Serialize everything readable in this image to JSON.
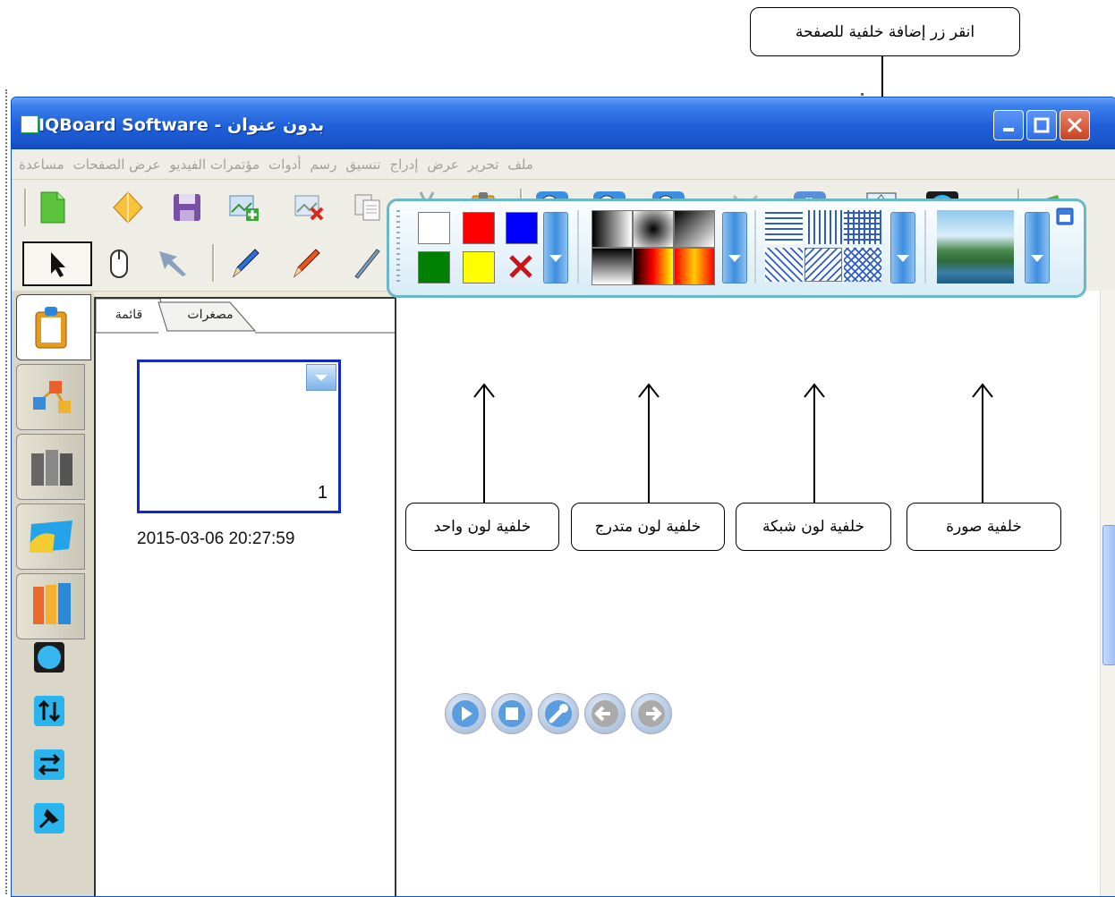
{
  "window": {
    "title": "IQBoard Software - بدون عنوان",
    "controls": [
      "minimize",
      "maximize",
      "close"
    ]
  },
  "menu": {
    "items": [
      "ملف",
      "تحرير",
      "عرض",
      "إدراج",
      "تنسيق",
      "رسم",
      "أدوات",
      "مؤتمرات الفيديو",
      "عرض الصفحات",
      "مساعدة"
    ]
  },
  "panel": {
    "tabs": [
      "قائمة",
      "مصغرات"
    ],
    "page_number": "1",
    "page_timestamp": "2015-03-06 20:27:59"
  },
  "background_bar": {
    "solid_colors": [
      "#ffffff",
      "#ff0000",
      "#0000ff",
      "#008000",
      "#ffff00"
    ]
  },
  "callouts": {
    "top": "انقر زر إضافة خلفية للصفحة",
    "solid": "خلفية لون واحد",
    "gradient": "خلفية لون متدرج",
    "grid": "خلفية لون شبكة",
    "image": "خلفية صورة"
  },
  "icons": {
    "toolbar1": [
      "new-page-icon",
      "open-icon",
      "save-icon",
      "insert-image-icon",
      "delete-image-icon",
      "copy-icon",
      "cut-icon",
      "paste-icon",
      "zoom-in-icon",
      "zoom-out-icon",
      "zoom-fit-icon",
      "shrink-icon",
      "pan-hand-icon",
      "page-background-icon",
      "fullscreen-icon",
      "recycle-icon"
    ],
    "toolbar2": [
      "select-arrow-icon",
      "mouse-icon",
      "pointer-icon",
      "pen-icon",
      "brush-icon",
      "highlighter-icon",
      "magic-pen-icon",
      "eraser-icon",
      "line-icon",
      "shape-icon",
      "chart-icon",
      "spotlight-icon",
      "pie-chart-icon",
      "bar-chart-icon",
      "fill-icon",
      "ruler-icon",
      "formula-icon"
    ]
  }
}
